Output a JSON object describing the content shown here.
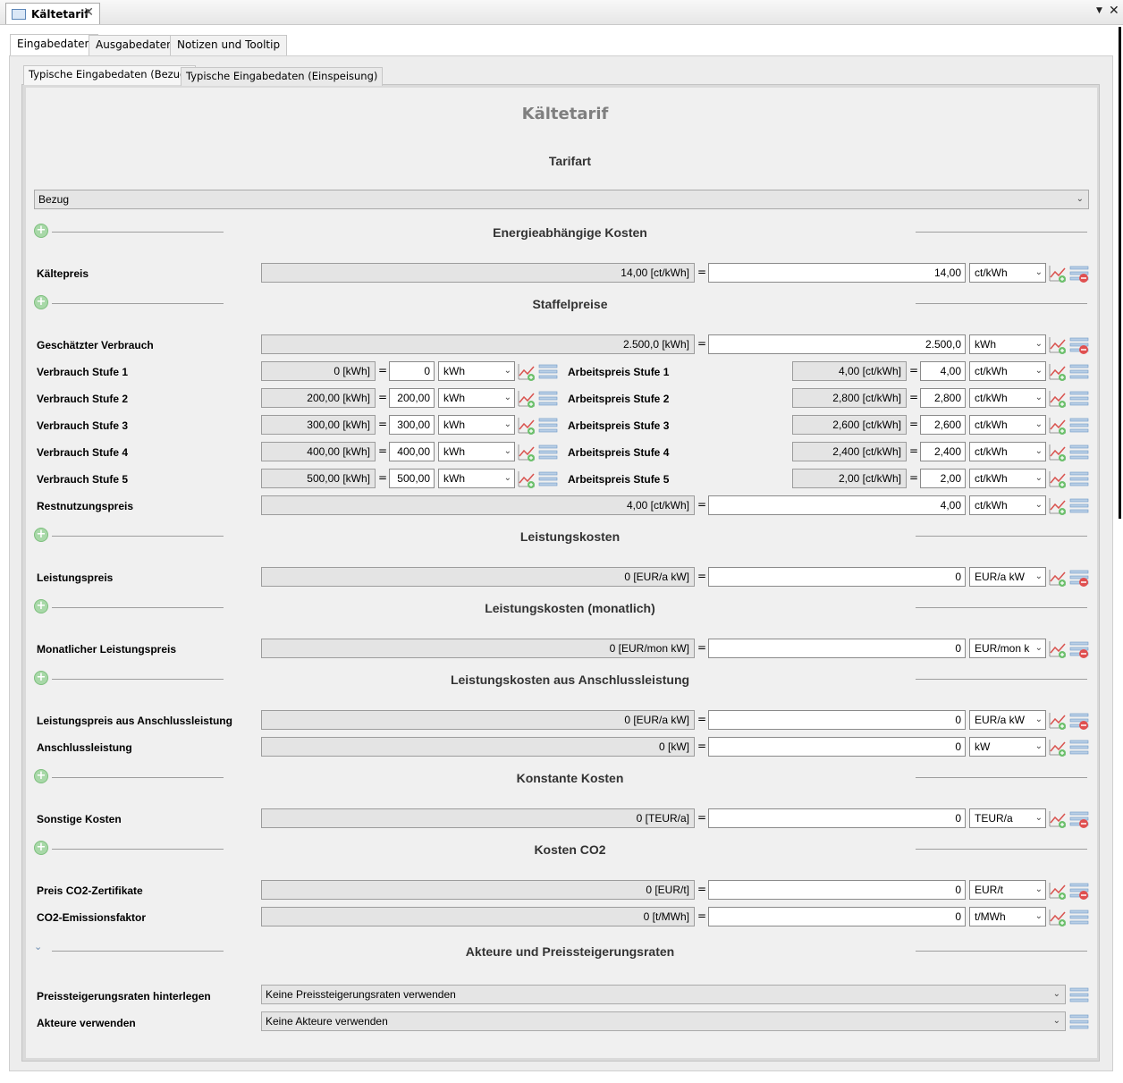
{
  "window": {
    "tab_title": "Kältetarif",
    "close_glyph": "✕",
    "menu_glyph": "▼"
  },
  "outer_tabs": [
    {
      "label": "Eingabedaten",
      "active": true
    },
    {
      "label": "Ausgabedaten",
      "active": false
    },
    {
      "label": "Notizen und Tooltip",
      "active": false
    }
  ],
  "inner_tabs": [
    {
      "label": "Typische Eingabedaten (Bezug)",
      "active": true
    },
    {
      "label": "Typische Eingabedaten (Einspeisung)",
      "active": false
    }
  ],
  "page": {
    "title": "Kältetarif"
  },
  "tarifart": {
    "heading": "Tarifart",
    "value": "Bezug"
  },
  "sections": {
    "energie": "Energieabhängige Kosten",
    "staffel": "Staffelpreise",
    "leistung": "Leistungskosten",
    "leistung_monat": "Leistungskosten (monatlich)",
    "anschluss": "Leistungskosten aus Anschlussleistung",
    "konstant": "Konstante Kosten",
    "co2": "Kosten CO2",
    "akteure": "Akteure und Preissteigerungsraten"
  },
  "eq": "=",
  "rows": {
    "kaeltepreis": {
      "label": "Kältepreis",
      "display": "14,00 [ct/kWh]",
      "value": "14,00",
      "unit": "ct/kWh"
    },
    "verbrauch": {
      "label": "Geschätzter Verbrauch",
      "display": "2.500,0 [kWh]",
      "value": "2.500,0",
      "unit": "kWh"
    },
    "rest": {
      "label": "Restnutzungspreis",
      "display": "4,00 [ct/kWh]",
      "value": "4,00",
      "unit": "ct/kWh"
    },
    "leistungspreis": {
      "label": "Leistungspreis",
      "display": "0 [EUR/a kW]",
      "value": "0",
      "unit": "EUR/a kW"
    },
    "monatlich": {
      "label": "Monatlicher Leistungspreis",
      "display": "0 [EUR/mon kW]",
      "value": "0",
      "unit": "EUR/mon k"
    },
    "anschlusspreis": {
      "label": "Leistungspreis aus Anschlussleistung",
      "display": "0 [EUR/a kW]",
      "value": "0",
      "unit": "EUR/a kW"
    },
    "anschlussleistung": {
      "label": "Anschlussleistung",
      "display": "0 [kW]",
      "value": "0",
      "unit": "kW"
    },
    "sonstige": {
      "label": "Sonstige Kosten",
      "display": "0 [TEUR/a]",
      "value": "0",
      "unit": "TEUR/a"
    },
    "co2preis": {
      "label": "Preis CO2-Zertifikate",
      "display": "0 [EUR/t]",
      "value": "0",
      "unit": "EUR/t"
    },
    "co2faktor": {
      "label": "CO2-Emissionsfaktor",
      "display": "0 [t/MWh]",
      "value": "0",
      "unit": "t/MWh"
    }
  },
  "stufen": [
    {
      "label": "Verbrauch Stufe 1",
      "display": "0 [kWh]",
      "value": "0",
      "unit": "kWh",
      "plabel": "Arbeitspreis Stufe 1",
      "pdisplay": "4,00 [ct/kWh]",
      "pvalue": "4,00",
      "punit": "ct/kWh"
    },
    {
      "label": "Verbrauch Stufe 2",
      "display": "200,00 [kWh]",
      "value": "200,00",
      "unit": "kWh",
      "plabel": "Arbeitspreis Stufe 2",
      "pdisplay": "2,800 [ct/kWh]",
      "pvalue": "2,800",
      "punit": "ct/kWh"
    },
    {
      "label": "Verbrauch Stufe 3",
      "display": "300,00 [kWh]",
      "value": "300,00",
      "unit": "kWh",
      "plabel": "Arbeitspreis Stufe 3",
      "pdisplay": "2,600 [ct/kWh]",
      "pvalue": "2,600",
      "punit": "ct/kWh"
    },
    {
      "label": "Verbrauch Stufe 4",
      "display": "400,00 [kWh]",
      "value": "400,00",
      "unit": "kWh",
      "plabel": "Arbeitspreis Stufe 4",
      "pdisplay": "2,400 [ct/kWh]",
      "pvalue": "2,400",
      "punit": "ct/kWh"
    },
    {
      "label": "Verbrauch Stufe 5",
      "display": "500,00 [kWh]",
      "value": "500,00",
      "unit": "kWh",
      "plabel": "Arbeitspreis Stufe 5",
      "pdisplay": "2,00 [ct/kWh]",
      "pvalue": "2,00",
      "punit": "ct/kWh"
    }
  ],
  "akteure": {
    "preis_label": "Preissteigerungsraten hinterlegen",
    "preis_value": "Keine Preissteigerungsraten verwenden",
    "akteure_label": "Akteure verwenden",
    "akteure_value": "Keine Akteure verwenden"
  },
  "icons": {
    "plus": "+",
    "chevron": "⌄",
    "dropdown": "⌄"
  }
}
